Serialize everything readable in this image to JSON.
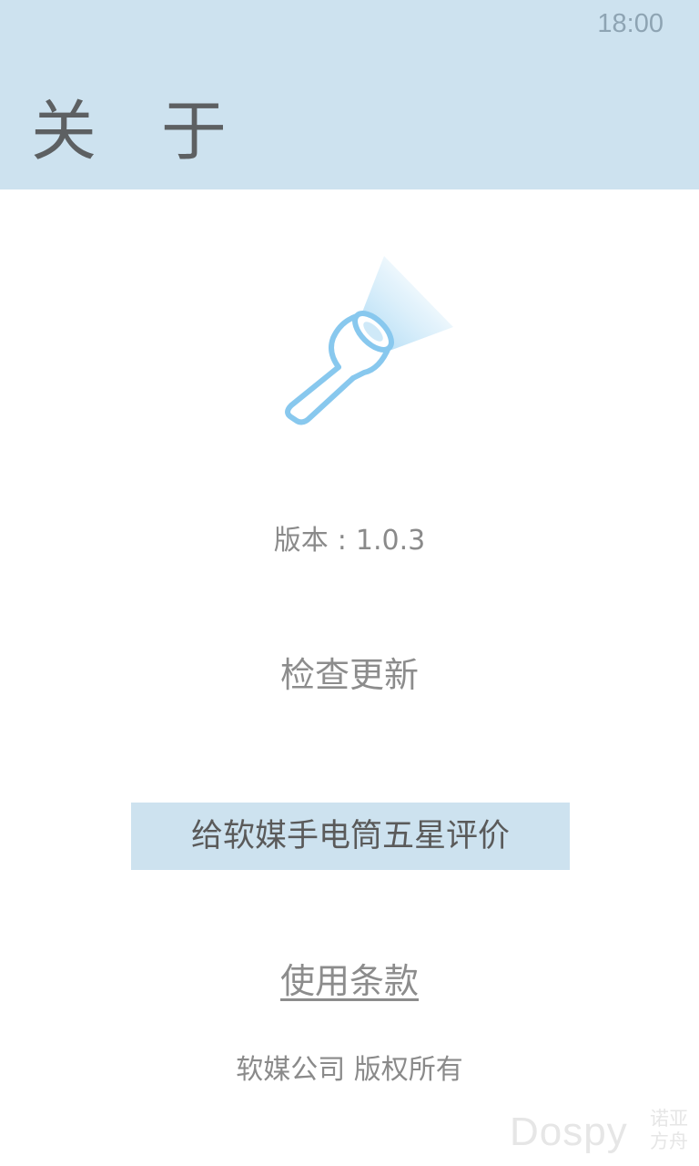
{
  "status_bar": {
    "time": "18:00"
  },
  "header": {
    "title": "关 于"
  },
  "logo": {
    "icon": "flashlight-icon",
    "color": "#88c8ee"
  },
  "version": {
    "label": "版本",
    "separator": ":",
    "value": "1.0.3"
  },
  "actions": {
    "check_update": "检查更新",
    "rate_five_stars": "给软媒手电筒五星评价",
    "terms_of_use": "使用条款"
  },
  "footer": {
    "copyright": "软媒公司 版权所有"
  },
  "watermark": {
    "main": "Dospy",
    "side_line1": "诺亚",
    "side_line2": "方舟"
  },
  "colors": {
    "header_bg": "#cde2ef",
    "button_bg": "#cde2ef",
    "text_gray": "#8c8c8c"
  }
}
